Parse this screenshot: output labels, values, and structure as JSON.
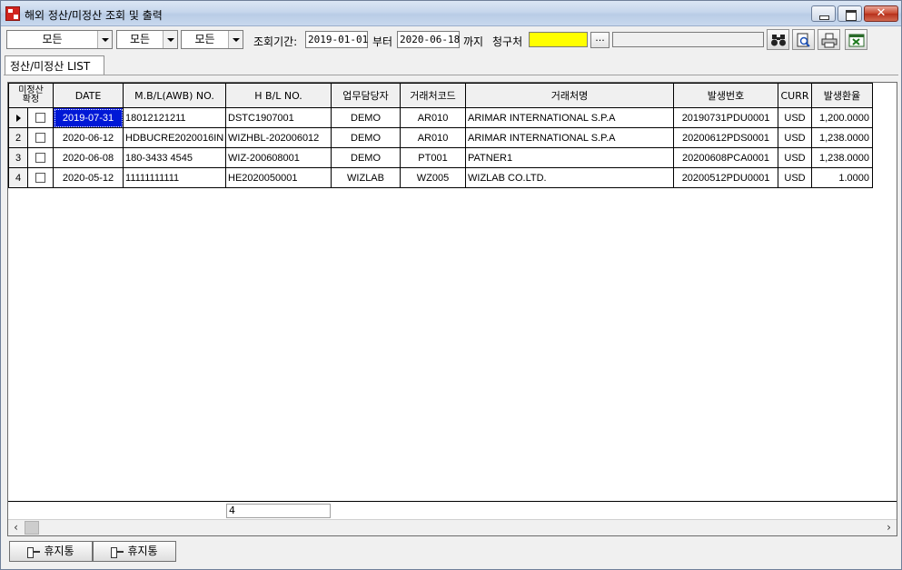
{
  "window": {
    "title": "해외 정산/미정산 조회 및 출력"
  },
  "toolbar": {
    "combo1": "모든",
    "combo2": "모든",
    "combo3": "모든",
    "period_label": "조회기간:",
    "date_from": "2019-01-01",
    "from_label": "부터",
    "date_to": "2020-06-18",
    "to_label": "까지",
    "billing_label": "청구처",
    "billing_code": "",
    "ellipsis": "...",
    "billing_name": "",
    "icons": [
      "binoculars-icon",
      "print-preview-icon",
      "printer-icon",
      "excel-export-icon"
    ]
  },
  "tab": {
    "label": "정산/미정산 LIST"
  },
  "grid": {
    "headers": {
      "confirm_line1": "미정산",
      "confirm_line2": "확정",
      "date": "DATE",
      "mbl": "M.B/L(AWB) NO.",
      "hbl": "H B/L NO.",
      "staff": "업무담당자",
      "client_code": "거래처코드",
      "client_name": "거래처명",
      "issue_no": "발생번호",
      "curr": "CURR",
      "rate": "발생환율"
    },
    "rows": [
      {
        "num": "",
        "date": "2019-07-31",
        "mbl": "18012121211",
        "hbl": "DSTC1907001",
        "staff": "DEMO",
        "client_code": "AR010",
        "client_name": "ARIMAR INTERNATIONAL S.P.A",
        "issue_no": "20190731PDU0001",
        "curr": "USD",
        "rate": "1,200.0000"
      },
      {
        "num": "2",
        "date": "2020-06-12",
        "mbl": "HDBUCRE2020016IN",
        "hbl": "WIZHBL-202006012",
        "staff": "DEMO",
        "client_code": "AR010",
        "client_name": "ARIMAR INTERNATIONAL S.P.A",
        "issue_no": "20200612PDS0001",
        "curr": "USD",
        "rate": "1,238.0000"
      },
      {
        "num": "3",
        "date": "2020-06-08",
        "mbl": "180-3433 4545",
        "hbl": "WIZ-200608001",
        "staff": "DEMO",
        "client_code": "PT001",
        "client_name": "PATNER1",
        "issue_no": "20200608PCA0001",
        "curr": "USD",
        "rate": "1,238.0000"
      },
      {
        "num": "4",
        "date": "2020-05-12",
        "mbl": "11111111111",
        "hbl": "HE2020050001",
        "staff": "WIZLAB",
        "client_code": "WZ005",
        "client_name": "WIZLAB CO.LTD.",
        "issue_no": "20200512PDU0001",
        "curr": "USD",
        "rate": "1.0000"
      }
    ],
    "footer_count": "4"
  },
  "bottom": {
    "btn1": "휴지통",
    "btn2": "휴지통"
  }
}
